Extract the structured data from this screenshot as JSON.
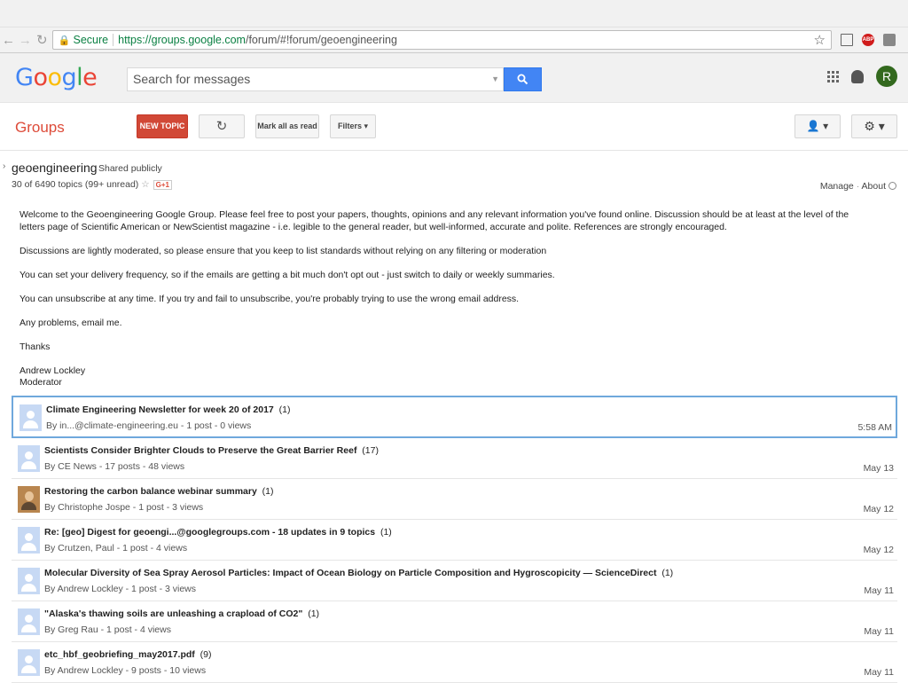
{
  "browser": {
    "secure_label": "Secure",
    "url_host": "https://groups.google.com",
    "url_path": "/forum/#!forum/geoengineering",
    "abp_label": "ABP"
  },
  "header": {
    "logo": "Google",
    "search_placeholder": "Search for messages",
    "avatar_letter": "R"
  },
  "toolbar": {
    "title": "Groups",
    "new_topic": "NEW TOPIC",
    "mark_all_read": "Mark all as read",
    "filters": "Filters"
  },
  "group": {
    "name": "geoengineering",
    "visibility": "Shared publicly",
    "topic_count": "30 of 6490 topics (99+ unread)",
    "gplus": "G+1",
    "manage": "Manage",
    "about": "About",
    "dot": "·"
  },
  "welcome": [
    "Welcome to the Geoengineering Google Group.  Please feel free to post your papers, thoughts, opinions and any relevant information you've found online.  Discussion should be at least at the level of the letters page of Scientific American or NewScientist magazine - i.e. legible to the general reader, but well-informed, accurate and polite.  References are strongly encouraged.",
    "Discussions are lightly moderated, so please ensure that you keep to list standards without relying on any filtering or moderation",
    "You can set your delivery frequency, so if the emails are getting a bit much don't opt out - just switch to daily or weekly summaries.",
    "You can unsubscribe at any time.  If you try and fail to unsubscribe, you're probably trying to use the wrong email address.",
    "Any problems, email me.",
    "Thanks",
    "Andrew Lockley",
    "Moderator"
  ],
  "topics": [
    {
      "title": "Climate Engineering Newsletter for week 20 of 2017",
      "count": "(1)",
      "meta": "By in...@climate-engineering.eu - 1 post - 0 views",
      "date": "5:58 AM"
    },
    {
      "title": "Scientists Consider Brighter Clouds to Preserve the Great Barrier Reef",
      "count": "(17)",
      "meta": "By CE News - 17 posts - 48 views",
      "date": "May 13"
    },
    {
      "title": "Restoring the carbon balance webinar summary",
      "count": "(1)",
      "meta": "By Christophe Jospe - 1 post - 3 views",
      "date": "May 12"
    },
    {
      "title": "Re: [geo] Digest for geoengi...@googlegroups.com - 18 updates in 9 topics",
      "count": "(1)",
      "meta": "By Crutzen, Paul - 1 post - 4 views",
      "date": "May 12"
    },
    {
      "title": "Molecular Diversity of Sea Spray Aerosol Particles: Impact of Ocean Biology on Particle Composition and Hygroscopicity — ScienceDirect",
      "count": "(1)",
      "meta": "By Andrew Lockley - 1 post - 3 views",
      "date": "May 11"
    },
    {
      "title": "\"Alaska's thawing soils are unleashing a crapload of CO2\"",
      "count": "(1)",
      "meta": "By Greg Rau - 1 post - 4 views",
      "date": "May 11"
    },
    {
      "title": "etc_hbf_geobriefing_may2017.pdf",
      "count": "(9)",
      "meta": "By Andrew Lockley - 9 posts - 10 views",
      "date": "May 11"
    }
  ]
}
